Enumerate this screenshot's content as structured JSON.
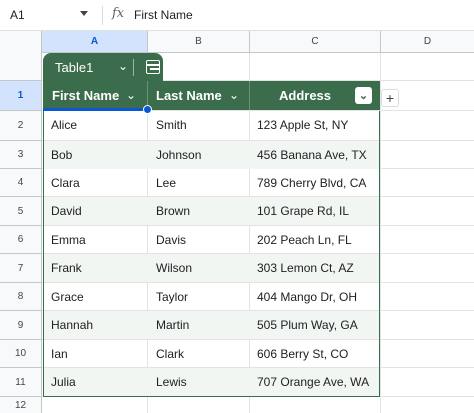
{
  "formula_bar": {
    "cell_ref": "A1",
    "fx": "fx",
    "content": "First Name"
  },
  "columns": [
    "A",
    "B",
    "C",
    "D"
  ],
  "rows": [
    "1",
    "2",
    "3",
    "4",
    "5",
    "6",
    "7",
    "8",
    "9",
    "10",
    "11",
    "12"
  ],
  "table": {
    "name": "Table1",
    "headers": [
      "First Name",
      "Last Name",
      "Address"
    ],
    "add_column": "+",
    "rows": [
      [
        "Alice",
        "Smith",
        "123 Apple St, NY"
      ],
      [
        "Bob",
        "Johnson",
        "456 Banana Ave, TX"
      ],
      [
        "Clara",
        "Lee",
        "789 Cherry Blvd, CA"
      ],
      [
        "David",
        "Brown",
        "101 Grape Rd, IL"
      ],
      [
        "Emma",
        "Davis",
        "202 Peach Ln, FL"
      ],
      [
        "Frank",
        "Wilson",
        "303 Lemon Ct, AZ"
      ],
      [
        "Grace",
        "Taylor",
        "404 Mango Dr, OH"
      ],
      [
        "Hannah",
        "Martin",
        "505 Plum Way, GA"
      ],
      [
        "Ian",
        "Clark",
        "606 Berry St, CO"
      ],
      [
        "Julia",
        "Lewis",
        "707 Orange Ave, WA"
      ]
    ]
  },
  "colors": {
    "table_header": "#3b6d4d",
    "selection": "#0b57d0",
    "alt_row": "#f1f6f2"
  }
}
